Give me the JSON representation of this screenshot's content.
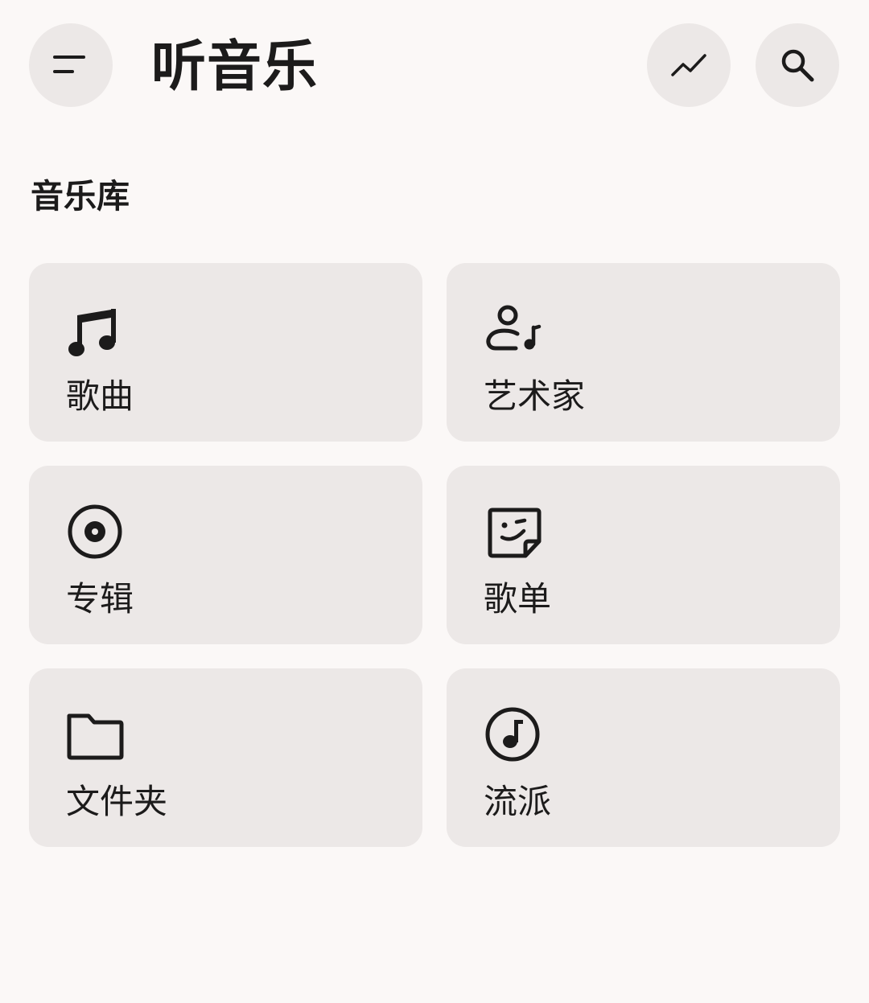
{
  "header": {
    "title": "听音乐",
    "menu_icon": "menu-icon",
    "trend_icon": "trending-icon",
    "search_icon": "search-icon"
  },
  "library": {
    "title": "音乐库",
    "items": [
      {
        "label": "歌曲",
        "icon": "music-note-icon"
      },
      {
        "label": "艺术家",
        "icon": "artist-icon"
      },
      {
        "label": "专辑",
        "icon": "album-icon"
      },
      {
        "label": "歌单",
        "icon": "playlist-icon"
      },
      {
        "label": "文件夹",
        "icon": "folder-icon"
      },
      {
        "label": "流派",
        "icon": "genre-icon"
      }
    ]
  },
  "colors": {
    "background": "#fbf8f7",
    "surface": "#ece8e7",
    "text": "#1c1b1b"
  }
}
